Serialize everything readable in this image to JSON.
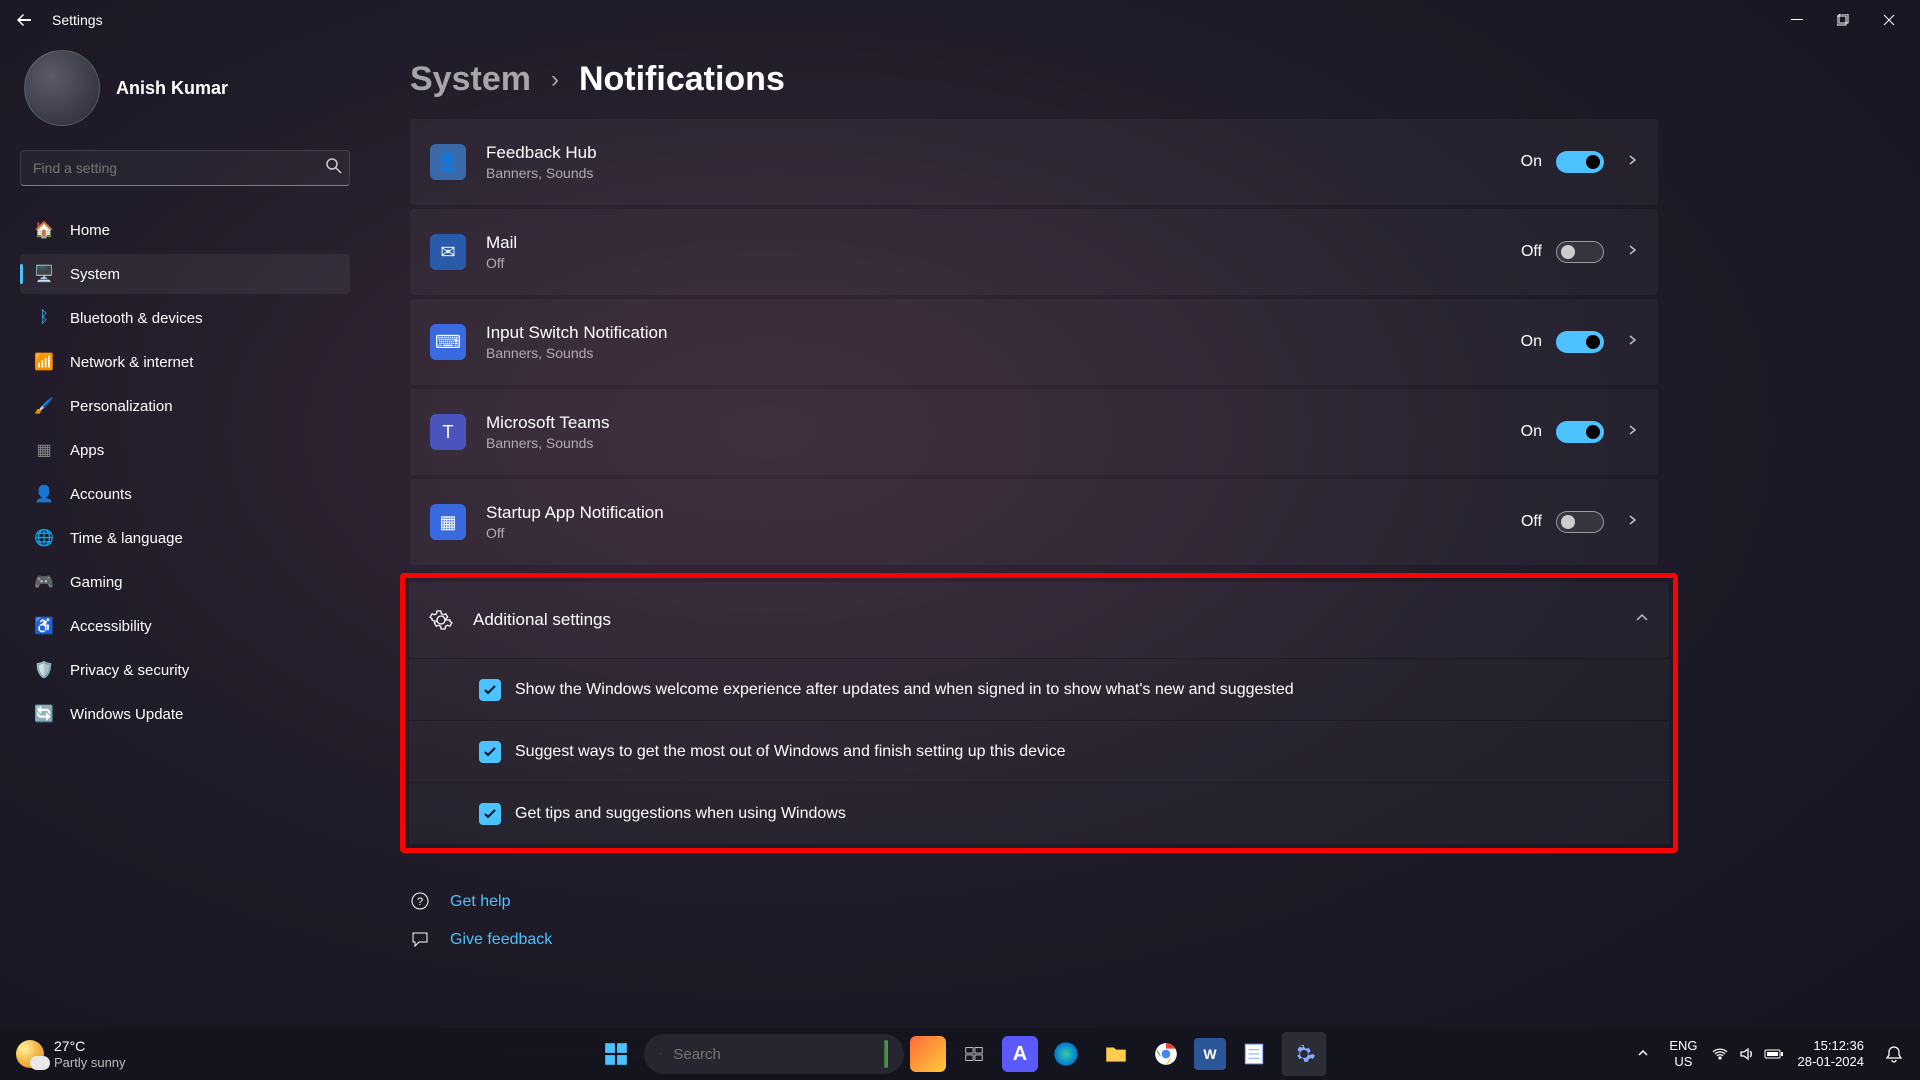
{
  "titlebar": {
    "title": "Settings"
  },
  "user": {
    "name": "Anish Kumar"
  },
  "search": {
    "placeholder": "Find a setting"
  },
  "nav": [
    {
      "label": "Home",
      "icon": "🏠",
      "color": "#e88c30"
    },
    {
      "label": "System",
      "icon": "🖥️",
      "color": "#4cc2ff",
      "active": true
    },
    {
      "label": "Bluetooth & devices",
      "icon": "ᛒ",
      "color": "#4cc2ff"
    },
    {
      "label": "Network & internet",
      "icon": "📶",
      "color": "#4cc2ff"
    },
    {
      "label": "Personalization",
      "icon": "🖌️",
      "color": "#c77dff"
    },
    {
      "label": "Apps",
      "icon": "▦",
      "color": "#888"
    },
    {
      "label": "Accounts",
      "icon": "👤",
      "color": "#ff8c5a"
    },
    {
      "label": "Time & language",
      "icon": "🌐",
      "color": "#66cc99"
    },
    {
      "label": "Gaming",
      "icon": "🎮",
      "color": "#888"
    },
    {
      "label": "Accessibility",
      "icon": "♿",
      "color": "#5a9aff"
    },
    {
      "label": "Privacy & security",
      "icon": "🛡️",
      "color": "#5a9aff"
    },
    {
      "label": "Windows Update",
      "icon": "🔄",
      "color": "#ff9a3a"
    }
  ],
  "breadcrumb": {
    "parent": "System",
    "current": "Notifications"
  },
  "apps": [
    {
      "name": "Feedback Hub",
      "sub": "Banners, Sounds",
      "state": "On",
      "on": true,
      "bg": "#3a6aaa",
      "glyph": "👤"
    },
    {
      "name": "Mail",
      "sub": "Off",
      "state": "Off",
      "on": false,
      "bg": "#2a5aaa",
      "glyph": "✉"
    },
    {
      "name": "Input Switch Notification",
      "sub": "Banners, Sounds",
      "state": "On",
      "on": true,
      "bg": "#3a6adf",
      "glyph": "⌨"
    },
    {
      "name": "Microsoft Teams",
      "sub": "Banners, Sounds",
      "state": "On",
      "on": true,
      "bg": "#4b53bc",
      "glyph": "T"
    },
    {
      "name": "Startup App Notification",
      "sub": "Off",
      "state": "Off",
      "on": false,
      "bg": "#3a6adf",
      "glyph": "▦"
    }
  ],
  "additional": {
    "title": "Additional settings",
    "items": [
      {
        "label": "Show the Windows welcome experience after updates and when signed in to show what's new and suggested",
        "checked": true
      },
      {
        "label": "Suggest ways to get the most out of Windows and finish setting up this device",
        "checked": true
      },
      {
        "label": "Get tips and suggestions when using Windows",
        "checked": true
      }
    ]
  },
  "footer": {
    "help": "Get help",
    "feedback": "Give feedback"
  },
  "taskbar": {
    "weather": {
      "temp": "27°C",
      "desc": "Partly sunny"
    },
    "search_placeholder": "Search",
    "lang1": "ENG",
    "lang2": "US",
    "time": "15:12:36",
    "date": "28-01-2024"
  }
}
